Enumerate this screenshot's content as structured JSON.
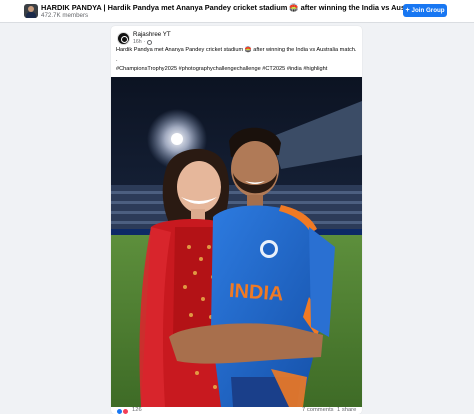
{
  "group": {
    "title": "HARDIK PANDYA | Hardik Pandya met Ananya Pandey cricket stadium 🏟️ after winning the India vs Australia match",
    "members": "472.7K members",
    "join_label": "Join Group",
    "join_icon": "plus-icon"
  },
  "post": {
    "author": "Rajashree YT",
    "time": "16h",
    "separator": "·",
    "privacy_icon": "globe-icon",
    "text_line1": "Hardik Pandya met Ananya Pandey  cricket stadium 🏟️ after winning the India vs Australia match.",
    "text_line2": ".",
    "text_line3": "#ChampionsTrophy2025 #photographychallengechallenge #CT2025 #india #highlight",
    "jersey_text": "INDIA"
  },
  "footer": {
    "reactions": "126",
    "reaction_icons": [
      "like-icon",
      "love-icon"
    ],
    "comments": "7 comments",
    "shares": "1 share"
  },
  "colors": {
    "accent": "#1877f2",
    "jersey_blue": "#1e63c4",
    "jersey_orange": "#f07a24",
    "saree_red": "#c8191f"
  }
}
